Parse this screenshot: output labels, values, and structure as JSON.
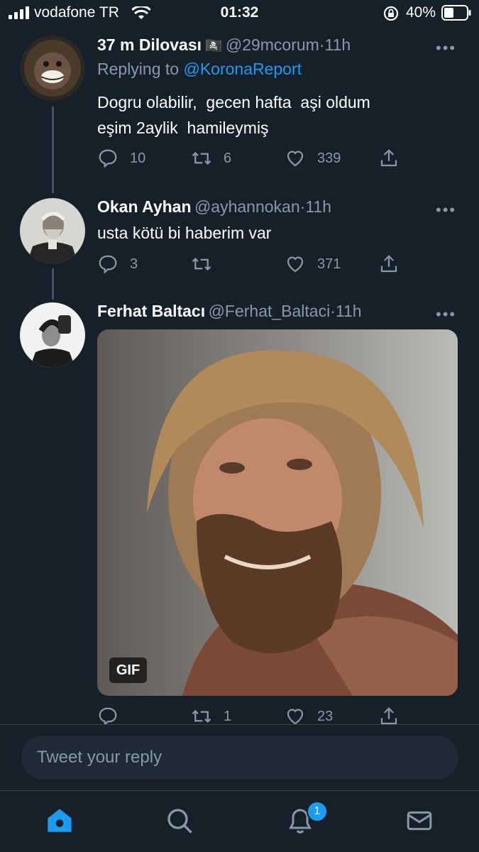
{
  "status_bar": {
    "carrier": "vodafone TR",
    "time": "01:32",
    "battery": "40%"
  },
  "tweets": [
    {
      "name": "37 m Dilovası",
      "name_emoji": "🏴‍☠️",
      "handle": "@29mcorum",
      "sep": "·",
      "time": "11h",
      "replying_prefix": "Replying to",
      "replying_to": "@KoronaReport",
      "text_line1": "Dogru olabilir,  gecen hafta  aşi oldum",
      "text_line2": "eşim 2aylik  hamileymiş",
      "replies": "10",
      "retweets": "6",
      "likes": "339",
      "more": "•••"
    },
    {
      "name": "Okan Ayhan",
      "handle": "@ayhannokan",
      "sep": "·",
      "time": "11h",
      "text_line1": "usta kötü bi haberim var",
      "replies": "3",
      "retweets": "",
      "likes": "371",
      "more": "•••"
    },
    {
      "name": "Ferhat Baltacı",
      "handle": "@Ferhat_Baltaci",
      "sep": "·",
      "time": "11h",
      "media_badge": "GIF",
      "replies": "",
      "retweets": "1",
      "likes": "23",
      "more": "•••"
    }
  ],
  "composer": {
    "placeholder": "Tweet your reply"
  },
  "tab_bar": {
    "notifications_badge": "1"
  },
  "colors": {
    "background": "#15202b",
    "accent": "#1d9bf0",
    "secondary_text": "#8899a6"
  },
  "icons": [
    "signal-icon",
    "wifi-icon",
    "lock-rotation-icon",
    "battery-icon",
    "reply-icon",
    "retweet-icon",
    "like-icon",
    "share-icon",
    "home-icon",
    "search-icon",
    "notifications-icon",
    "messages-icon"
  ]
}
